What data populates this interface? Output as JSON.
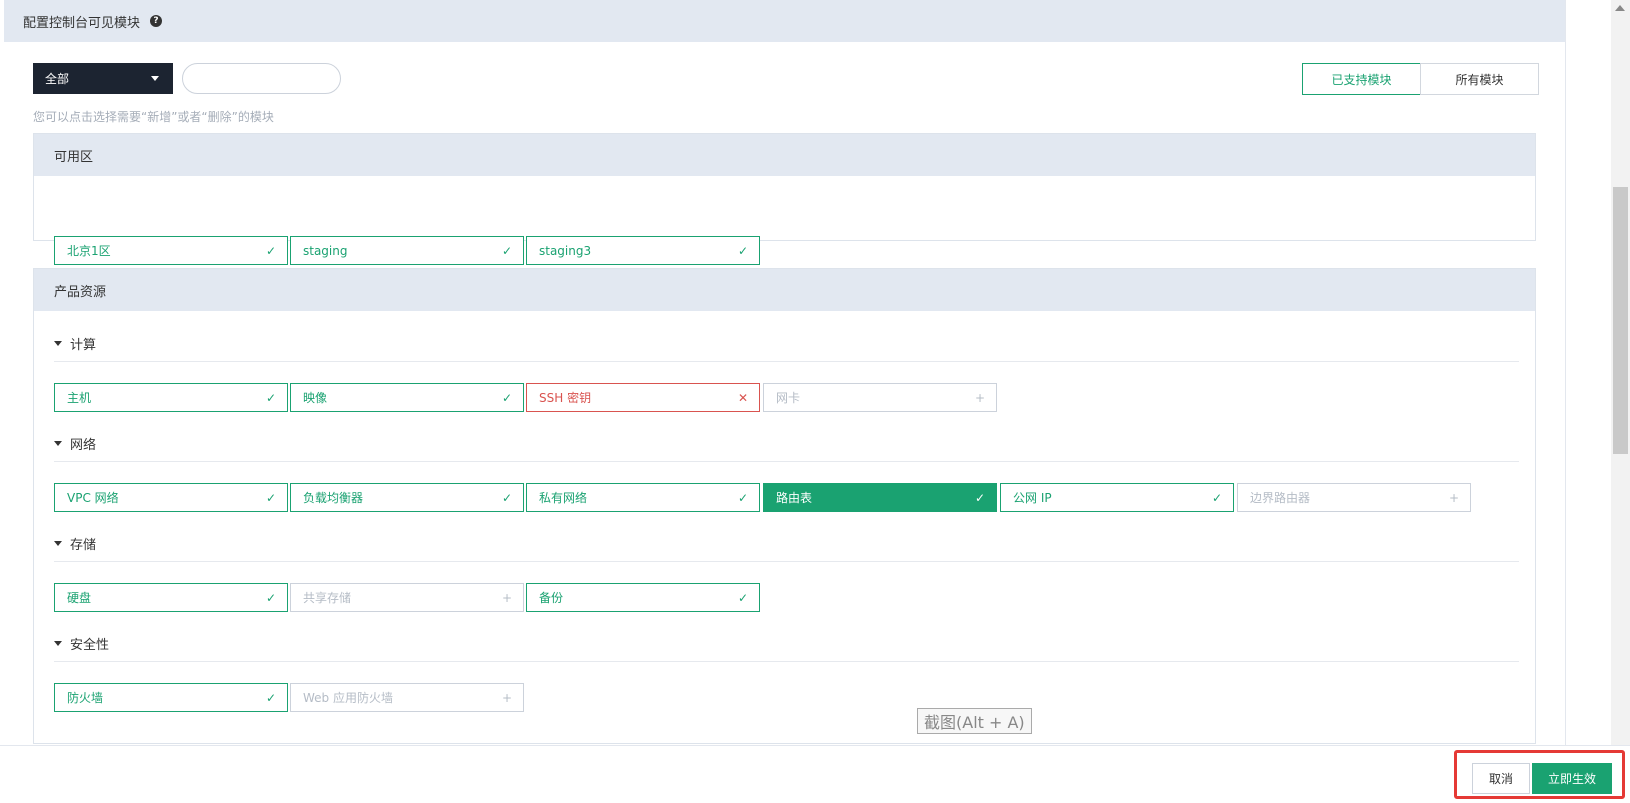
{
  "header": {
    "title": "配置控制台可见模块",
    "help_icon": "question-circle-icon"
  },
  "toolbar": {
    "select_value": "全部",
    "search_value": "",
    "hint": "您可以点击选择需要“新增”或者“删除”的模块"
  },
  "view_toggle": {
    "supported": "已支持模块",
    "all": "所有模块",
    "active": "supported"
  },
  "zones": {
    "title": "可用区",
    "items": [
      {
        "label": "北京1区",
        "state": "selected",
        "mark": "✓"
      },
      {
        "label": "staging",
        "state": "selected",
        "mark": "✓"
      },
      {
        "label": "staging3",
        "state": "selected",
        "mark": "✓"
      }
    ]
  },
  "products": {
    "title": "产品资源",
    "groups": [
      {
        "title": "计算",
        "items": [
          {
            "label": "主机",
            "state": "selected",
            "mark": "✓"
          },
          {
            "label": "映像",
            "state": "selected",
            "mark": "✓"
          },
          {
            "label": "SSH 密钥",
            "state": "remove",
            "mark": "✕"
          },
          {
            "label": "网卡",
            "state": "unselected",
            "mark": "+"
          }
        ]
      },
      {
        "title": "网络",
        "items": [
          {
            "label": "VPC 网络",
            "state": "selected",
            "mark": "✓"
          },
          {
            "label": "负载均衡器",
            "state": "selected",
            "mark": "✓"
          },
          {
            "label": "私有网络",
            "state": "selected",
            "mark": "✓"
          },
          {
            "label": "路由表",
            "state": "active",
            "mark": "✓"
          },
          {
            "label": "公网 IP",
            "state": "selected",
            "mark": "✓"
          },
          {
            "label": "边界路由器",
            "state": "unselected",
            "mark": "+"
          }
        ]
      },
      {
        "title": "存储",
        "items": [
          {
            "label": "硬盘",
            "state": "selected",
            "mark": "✓"
          },
          {
            "label": "共享存储",
            "state": "unselected",
            "mark": "+"
          },
          {
            "label": "备份",
            "state": "selected",
            "mark": "✓"
          }
        ]
      },
      {
        "title": "安全性",
        "items": [
          {
            "label": "防火墙",
            "state": "selected",
            "mark": "✓"
          },
          {
            "label": "Web 应用防火墙",
            "state": "unselected",
            "mark": "+"
          }
        ]
      }
    ]
  },
  "tooltip": "截图(Alt + A)",
  "footer": {
    "cancel": "取消",
    "apply": "立即生效"
  },
  "colors": {
    "accent": "#1aa271",
    "danger": "#d9534f",
    "dark": "#1c2431",
    "highlight": "#e53935"
  }
}
